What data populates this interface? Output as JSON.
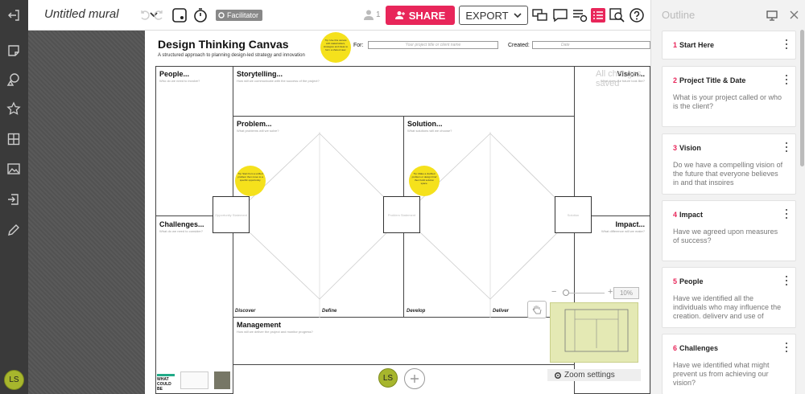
{
  "topbar": {
    "title": "Untitled mural",
    "facilitator": "Facilitator",
    "user_count": "1",
    "share": "SHARE",
    "export": "EXPORT"
  },
  "left_avatar": "LS",
  "canvas": {
    "heading": "Design Thinking Canvas",
    "subtitle": "A structured approach to planning design-led strategy and innovation",
    "for_label": "For:",
    "for_placeholder": "Your project title or client name",
    "created_label": "Created:",
    "date_placeholder": "Date",
    "saved_status": "All changes saved",
    "cells": {
      "people": {
        "title": "People...",
        "sub": "Who do we need to involve?"
      },
      "storytelling": {
        "title": "Storytelling...",
        "sub": "How will we communicate with the success of the project?"
      },
      "vision": {
        "title": "Vision...",
        "sub": "What does our future look like?"
      },
      "problem": {
        "title": "Problem...",
        "sub": "What problems will we solve?"
      },
      "solution": {
        "title": "Solution...",
        "sub": "What solutions will we choose?"
      },
      "challenges": {
        "title": "Challenges...",
        "sub": "What do we need to consider?"
      },
      "impact": {
        "title": "Impact...",
        "sub": "What difference will we make?"
      },
      "management": {
        "title": "Management",
        "sub": "How will we deliver the project and monitor progress?"
      }
    },
    "phases": {
      "discover": "Discover",
      "define": "Define",
      "develop": "Develop",
      "deliver": "Deliver"
    },
    "stickies": {
      "top": "Tip: Use this canvas with stakeholders, strategies and ideas to form a shared view.",
      "left": "Tip: Start from a unified problem then move to a specific opportunity.",
      "mid": "Tip: Make a clarified problem or design brief then build solution space."
    },
    "boxes": {
      "b1": "Opportunity Statement",
      "b2": "Problem Statement",
      "b3": "Solution"
    },
    "footer_logo": "WHAT COULD BE",
    "zoom_percent": "10%",
    "zoom_settings": "Zoom settings"
  },
  "bottom_avatar": "LS",
  "outline": {
    "title": "Outline",
    "items": [
      {
        "num": "1",
        "title": "Start Here",
        "desc": ""
      },
      {
        "num": "2",
        "title": "Project Title & Date",
        "desc": "What is your project called or who is the client?"
      },
      {
        "num": "3",
        "title": "Vision",
        "desc": "Do we have a compelling vision of the future that everyone believes in and that inspires"
      },
      {
        "num": "4",
        "title": "Impact",
        "desc": "Have we agreed upon measures of success?"
      },
      {
        "num": "5",
        "title": "People",
        "desc": "Have we identified all the individuals who may influence the creation, delivery and use of"
      },
      {
        "num": "6",
        "title": "Challenges",
        "desc": "Have we identified what might prevent us from achieving our vision?"
      }
    ]
  }
}
